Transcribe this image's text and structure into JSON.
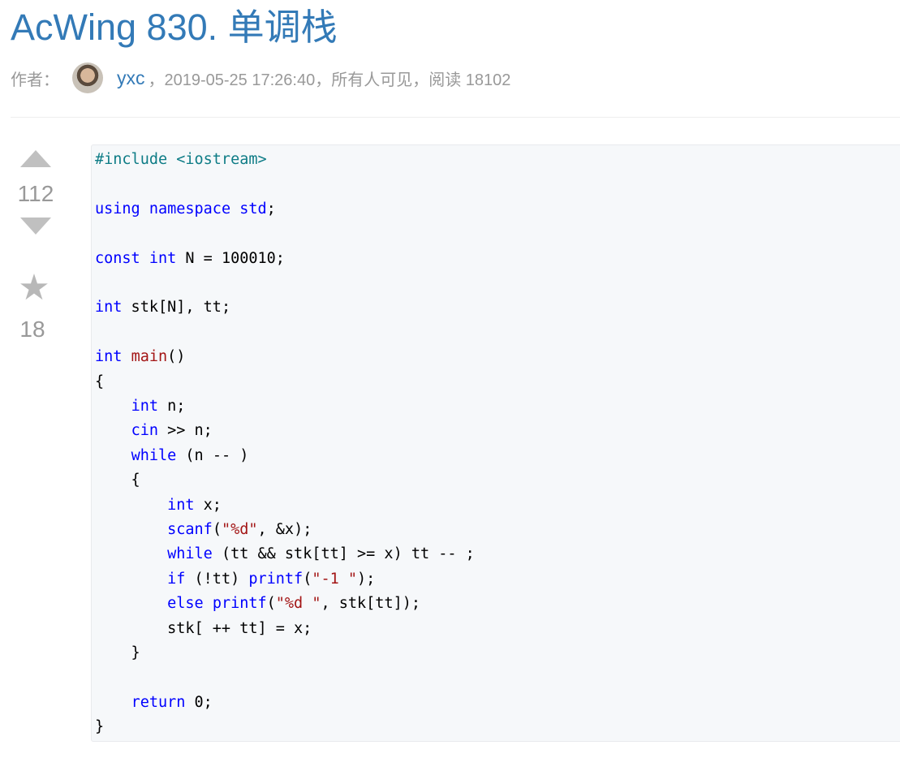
{
  "article": {
    "title": "AcWing 830. 单调栈",
    "author_label": "作者：",
    "author": "yxc",
    "meta_rest": "，2019-05-25 17:26:40，所有人可见，阅读 18102"
  },
  "sidebar": {
    "votes": "112",
    "favorites": "18"
  },
  "code": {
    "lines": [
      "#include <iostream>",
      "",
      "using namespace std;",
      "",
      "const int N = 100010;",
      "",
      "int stk[N], tt;",
      "",
      "int main()",
      "{",
      "    int n;",
      "    cin >> n;",
      "    while (n -- )",
      "    {",
      "        int x;",
      "        scanf(\"%d\", &x);",
      "        while (tt && stk[tt] >= x) tt -- ;",
      "        if (!tt) printf(\"-1 \");",
      "        else printf(\"%d \", stk[tt]);",
      "        stk[ ++ tt] = x;",
      "    }",
      "",
      "    return 0;",
      "}"
    ]
  },
  "colors": {
    "link": "#337ab7",
    "muted": "#999999",
    "keyword": "#0000ff",
    "preprocessor": "#0e7c86",
    "string": "#a31515",
    "code_bg": "#f6f8fa"
  }
}
